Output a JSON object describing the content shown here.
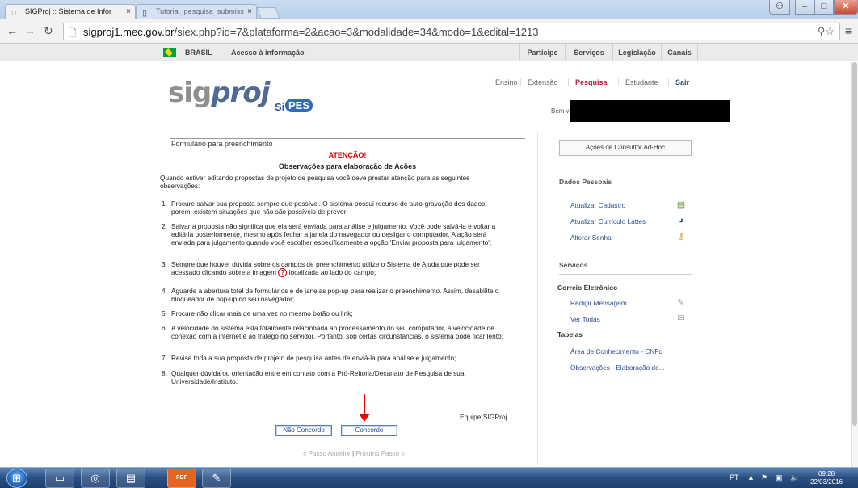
{
  "browser": {
    "tabs": [
      {
        "title": "SIGProj :: Sistema de Infor",
        "active": true
      },
      {
        "title": "Tutorial_pesquisa_submiss",
        "active": false
      }
    ],
    "url_host": "sigproj1.mec.gov.br",
    "url_path": "/siex.php?id=7&plataforma=2&acao=3&modalidade=34&modo=1&edital=1213",
    "close_glyph": "×"
  },
  "govbar": {
    "brasil": "BRASIL",
    "acesso": "Acesso à informação",
    "nav": [
      "Participe",
      "Serviços",
      "Legislação",
      "Canais"
    ]
  },
  "header": {
    "logo_sig": "sig",
    "logo_proj": "proj",
    "logo_si": "Si",
    "logo_pes": "PES",
    "nav": {
      "ensino": "Ensino",
      "extensao": "Extensão",
      "pesquisa": "Pesquisa",
      "estudante": "Estudante",
      "sair": "Sair"
    },
    "welcome": "Bem vindo(a)"
  },
  "form": {
    "section_title": "Formulário para preenchimento",
    "attention": "ATENÇÃO!",
    "obs_title": "Observações para elaboração de Ações",
    "intro": "Quando estiver editando propostas de projeto de pesquisa você deve prestar atenção para as seguintes observações:",
    "items": [
      {
        "n": "1.",
        "text": "Procure salvar sua proposta sempre que possível. O sistema possui recurso de auto-gravação dos dados, porém, existem situações que não são possíveis de prever;"
      },
      {
        "n": "2.",
        "text": "Salvar a proposta não significa que ela será enviada para análise e julgamento. Você pode salvá-la e voltar a editá-la posteriormente, mesmo após fechar a janela do navegador ou desligar o computador. A ação será enviada para julgamento quando você escolher especificamente a opção 'Enviar proposta para julgamento';"
      },
      {
        "n": "3.",
        "text_a": "Sempre que houver dúvida sobre os campos de preenchimento utilize o Sistema de Ajuda que pode ser acessado clicando sobre a imagem",
        "text_b": "localizada ao lado do campo;"
      },
      {
        "n": "4.",
        "text": "Aguarde a abertura total de formulários e de janelas pop-up para realizar o preenchimento. Assim, desabilite o bloqueador de pop-up do seu navegador;"
      },
      {
        "n": "5.",
        "text": "Procure não clicar mais de uma vez no mesmo botão ou link;"
      },
      {
        "n": "6.",
        "text": "A velocidade do sistema está totalmente relacionada ao processamento do seu computador, à velocidade de conexão com a internet e ao tráfego no servidor. Portanto, sob certas circunstâncias, o sistema pode ficar lento;"
      },
      {
        "n": "7.",
        "text": "Revise toda a sua proposta de projeto de pesquisa antes de enviá-la para análise e julgamento;"
      },
      {
        "n": "8.",
        "text": "Qualquer dúvida ou orientação entre em contato com a Pró-Reitoria/Decanato de Pesquisa de sua Universidade/Instituto."
      }
    ],
    "signature": "Equipe SIGProj",
    "btn_disagree": "Não Concordo",
    "btn_agree": "Concordo",
    "prev_step": "« Passo Anterior",
    "pager_sep": "|",
    "next_step": "Próximo Passo »"
  },
  "sidebar": {
    "adhoc": "Ações de Consultor Ad-Hoc",
    "personal_title": "Dados Pessoais",
    "update_profile": "Atualizar Cadastro",
    "update_lattes": "Atualizar Currículo Lattes",
    "change_password": "Alterar Senha",
    "services_title": "Serviços",
    "email_title": "Correio Eletrônico",
    "compose": "Redigir Mensagem",
    "view_all": "Ver Todas",
    "tables_title": "Tabelas",
    "cnpq": "Área de Conhecimento - CNPq",
    "obs_link": "Observações - Elaboração de..."
  },
  "taskbar": {
    "lang": "PT",
    "time": "09:28",
    "date": "22/03/2016",
    "pdf_label": "PDF"
  },
  "colors": {
    "accent_red": "#c0183c",
    "link_blue": "#2b4f8d",
    "attention_red": "#cc0000"
  }
}
